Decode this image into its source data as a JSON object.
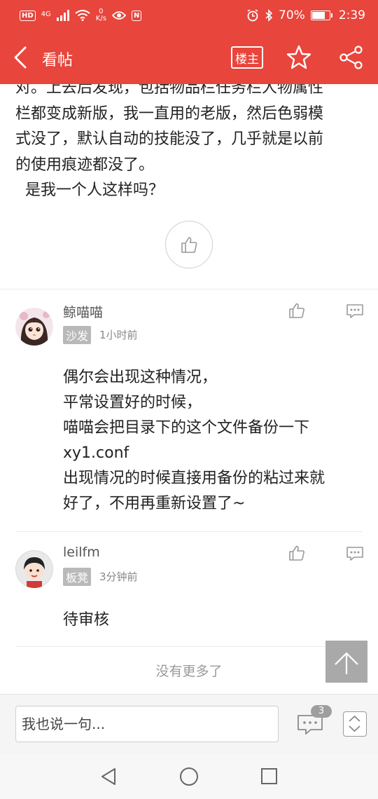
{
  "status_bar": {
    "hd_badge": "HD",
    "network": "4G",
    "speed_value": "0",
    "speed_unit": "K/s",
    "nfc_badge": "N",
    "battery": "70%",
    "battery_level": 0.7,
    "time": "2:39"
  },
  "header": {
    "title": "看帖",
    "owner_button": "楼主",
    "background_color": "#e8453c"
  },
  "post": {
    "lines": [
      "对。上去后发现，包括物品栏任务栏人物属性",
      "栏都变成新版，我一直用的老版，然后色弱模",
      "式没了，默认自动的技能没了，几乎就是以前",
      "的使用痕迹都没了。",
      "  是我一个人这样吗？"
    ]
  },
  "comments": [
    {
      "username": "鲸喵喵",
      "floor_tag": "沙发",
      "time": "1小时前",
      "lines": [
        "偶尔会出现这种情况，",
        "平常设置好的时候，",
        "喵喵会把目录下的这个文件备份一下",
        "xy1.conf",
        "出现情况的时候直接用备份的粘过来就",
        "好了，不用再重新设置了~"
      ]
    },
    {
      "username": "leilfm",
      "floor_tag": "板凳",
      "time": "3分钟前",
      "lines": [
        "待审核"
      ]
    }
  ],
  "footer_note": "没有更多了",
  "bottom_bar": {
    "input_placeholder": "我也说一句...",
    "comment_count": "3"
  }
}
